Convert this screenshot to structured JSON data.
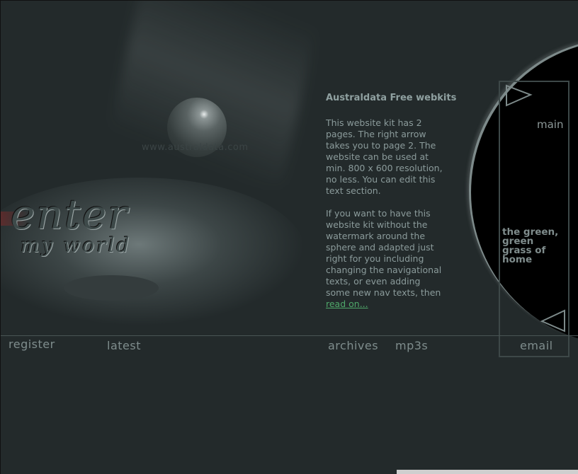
{
  "site": {
    "watermark": "www.australdata.com",
    "logo_line1": "enter",
    "logo_line2": "my world"
  },
  "content": {
    "title": "Australdata Free webkits",
    "paragraph1": "This website kit has 2 pages. The right arrow takes you  to page 2. The website can be used at min. 800 x 600 resolution, no less. You can edit this text section.",
    "paragraph2": "If you want to have this website kit without the watermark around the sphere and adapted just right for you including changing the navigational texts, or  even adding some new nav texts, then",
    "read_on": "read on..."
  },
  "side": {
    "main_label": "main",
    "tagline": "the green, green grass of home"
  },
  "nav": {
    "register": "register",
    "latest": "latest",
    "archives": "archives",
    "mp3s": "mp3s",
    "email": "email"
  },
  "icons": {
    "next": "arrow-right-icon",
    "prev": "arrow-left-icon"
  },
  "colors": {
    "background": "#232a2b",
    "text": "#8b9b9b",
    "link": "#4fa86a"
  }
}
